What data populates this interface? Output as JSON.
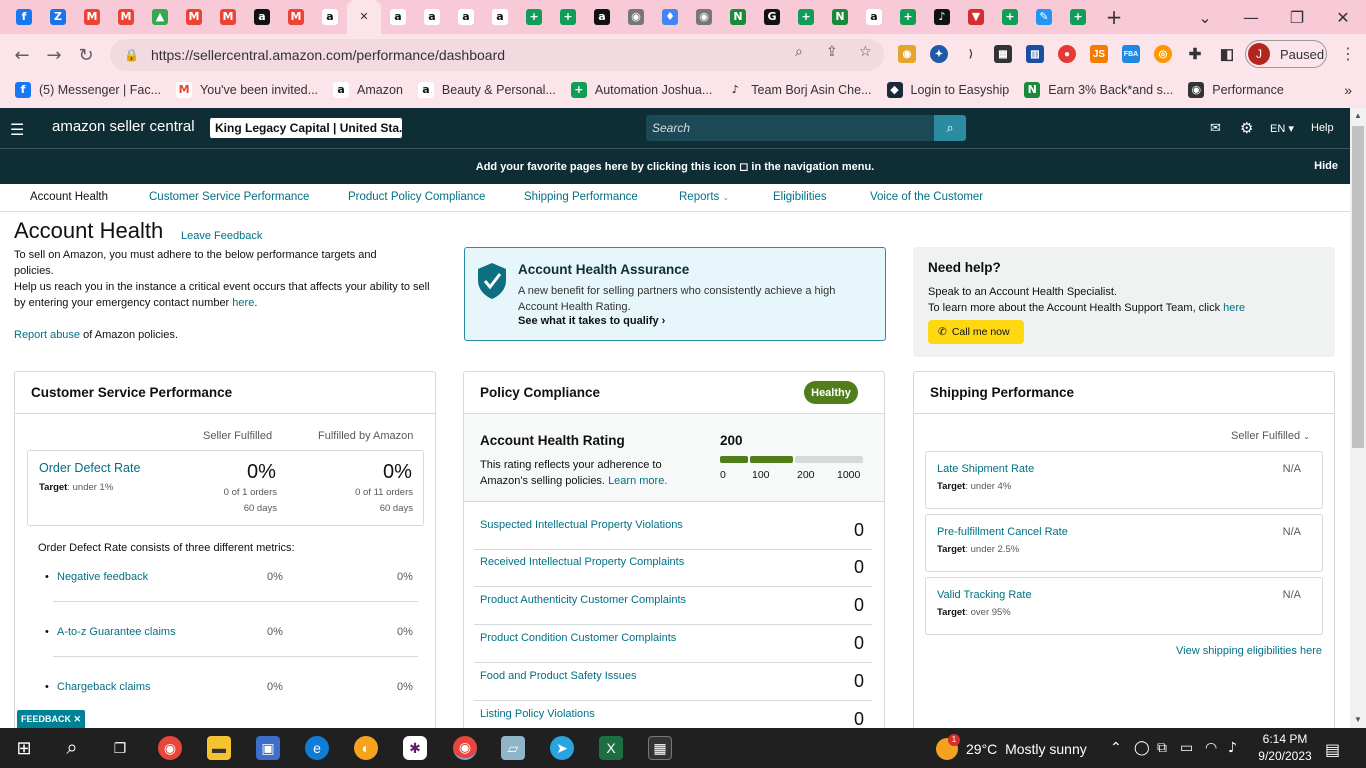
{
  "browser": {
    "tabs": [
      {
        "icon": "facebook-icon",
        "glyph": "f",
        "color": "#1877f2"
      },
      {
        "icon": "zoho-icon",
        "glyph": "Z",
        "color": "#1a73e8"
      },
      {
        "icon": "gmail-icon",
        "glyph": "M",
        "color": "#ea4335"
      },
      {
        "icon": "gmail-icon",
        "glyph": "M",
        "color": "#ea4335"
      },
      {
        "icon": "google-drive-icon",
        "glyph": "▲",
        "color": "#34a853"
      },
      {
        "icon": "gmail-icon",
        "glyph": "M",
        "color": "#ea4335"
      },
      {
        "icon": "gmail-icon",
        "glyph": "M",
        "color": "#ea4335"
      },
      {
        "icon": "amazon-icon",
        "glyph": "a",
        "color": "#ffffff"
      },
      {
        "icon": "gmail-icon",
        "glyph": "M",
        "color": "#ea4335"
      },
      {
        "icon": "amazon-icon",
        "glyph": "a",
        "color": "#111111"
      },
      {
        "icon": "close-tab-icon",
        "glyph": "✕",
        "color": "#333333"
      },
      {
        "icon": "amazon-icon",
        "glyph": "a",
        "color": "#111111"
      },
      {
        "icon": "amazon-icon",
        "glyph": "a",
        "color": "#111111"
      },
      {
        "icon": "amazon-icon",
        "glyph": "a",
        "color": "#111111"
      },
      {
        "icon": "amazon-icon",
        "glyph": "a",
        "color": "#111111"
      },
      {
        "icon": "google-sheets-icon",
        "glyph": "+",
        "color": "#0f9d58"
      },
      {
        "icon": "google-sheets-icon",
        "glyph": "+",
        "color": "#0f9d58"
      },
      {
        "icon": "amazon-icon",
        "glyph": "a",
        "color": "#ffffff"
      },
      {
        "icon": "globe-icon",
        "glyph": "◉",
        "color": "#777777"
      },
      {
        "icon": "google-maps-icon",
        "glyph": "♦",
        "color": "#4285f4"
      },
      {
        "icon": "globe-icon",
        "glyph": "◉",
        "color": "#777777"
      },
      {
        "icon": "vine-icon",
        "glyph": "N",
        "color": "#1a8a3a"
      },
      {
        "icon": "google-icon",
        "glyph": "G",
        "color": "#ffffff"
      },
      {
        "icon": "google-sheets-icon",
        "glyph": "+",
        "color": "#0f9d58"
      },
      {
        "icon": "vine-icon",
        "glyph": "N",
        "color": "#1a8a3a"
      },
      {
        "icon": "amazon-icon",
        "glyph": "a",
        "color": "#111111"
      },
      {
        "icon": "google-sheets-icon",
        "glyph": "+",
        "color": "#0f9d58"
      },
      {
        "icon": "tab-icon",
        "glyph": "♪",
        "color": "#ffffff"
      },
      {
        "icon": "triangle-icon",
        "glyph": "▼",
        "color": "#d32f2f"
      },
      {
        "icon": "google-sheets-icon",
        "glyph": "+",
        "color": "#0f9d58"
      },
      {
        "icon": "pencil-icon",
        "glyph": "✎",
        "color": "#2196f3"
      },
      {
        "icon": "google-sheets-icon",
        "glyph": "+",
        "color": "#0f9d58"
      }
    ],
    "url": "https://sellercentral.amazon.com/performance/dashboard",
    "profile_initial": "J",
    "profile_status": "Paused",
    "bookmarks": [
      {
        "label": "(5) Messenger | Fac...",
        "icon": "facebook-icon"
      },
      {
        "label": "You've been invited...",
        "icon": "gmail-icon"
      },
      {
        "label": "Amazon",
        "icon": "amazon-icon"
      },
      {
        "label": "Beauty & Personal...",
        "icon": "amazon-icon"
      },
      {
        "label": "Automation Joshua...",
        "icon": "google-sheets-icon"
      },
      {
        "label": "Team Borj Asin Che...",
        "icon": "tab-icon"
      },
      {
        "label": "Login to Easyship",
        "icon": "easyship-icon"
      },
      {
        "label": "Earn 3% Back*and s...",
        "icon": "vine-icon"
      },
      {
        "label": "Performance",
        "icon": "globe-icon"
      }
    ]
  },
  "seller": {
    "logo": "amazon seller central",
    "store": "King Legacy Capital | United Sta...",
    "search_placeholder": "Search",
    "lang": "EN",
    "help": "Help",
    "hint": "Add your favorite pages here by clicking this icon ◻ in the navigation menu.",
    "hide": "Hide",
    "nav": [
      "Account Health",
      "Customer Service Performance",
      "Product Policy Compliance",
      "Shipping Performance",
      "Reports",
      "Eligibilities",
      "Voice of the Customer"
    ]
  },
  "page": {
    "title": "Account Health",
    "leave_feedback": "Leave Feedback",
    "intro1": "To sell on Amazon, you must adhere to the below performance targets and policies.",
    "intro2": "Help us reach you in the instance a critical event occurs that affects your ability to sell by entering your emergency contact number",
    "intro2_link": "here",
    "report_abuse_link": "Report abuse",
    "report_abuse_text": "of Amazon policies.",
    "aha_title": "Account Health Assurance",
    "aha_desc": "A new benefit for selling partners who consistently achieve a high Account Health Rating.",
    "aha_link": "See what it takes to qualify",
    "help_title": "Need help?",
    "help_line1": "Speak to an Account Health Specialist.",
    "help_line2": "To learn more about the Account Health Support Team, click",
    "help_link": "here",
    "call_btn": "Call me now"
  },
  "csp": {
    "title": "Customer Service Performance",
    "col1": "Seller Fulfilled",
    "col2": "Fulfilled by Amazon",
    "odr_title": "Order Defect Rate",
    "odr_target_label": "Target",
    "odr_target": ": under 1%",
    "sf_pct": "0%",
    "sf_orders": "0 of 1 orders",
    "sf_days": "60 days",
    "fba_pct": "0%",
    "fba_orders": "0 of 11 orders",
    "fba_days": "60 days",
    "consists": "Order Defect Rate consists of three different metrics:",
    "metrics": [
      {
        "name": "Negative feedback",
        "sf": "0%",
        "fba": "0%"
      },
      {
        "name": "A-to-z Guarantee claims",
        "sf": "0%",
        "fba": "0%"
      },
      {
        "name": "Chargeback claims",
        "sf": "0%",
        "fba": "0%"
      }
    ]
  },
  "policy": {
    "title": "Policy Compliance",
    "status": "Healthy",
    "ahr_title": "Account Health Rating",
    "ahr_value": "200",
    "ahr_desc": "This rating reflects your adherence to Amazon's selling policies.",
    "ahr_link": "Learn more.",
    "scale": [
      "0",
      "100",
      "200",
      "1000"
    ],
    "scale_filled_segments": 2,
    "rows": [
      {
        "label": "Suspected Intellectual Property Violations",
        "value": "0"
      },
      {
        "label": "Received Intellectual Property Complaints",
        "value": "0"
      },
      {
        "label": "Product Authenticity Customer Complaints",
        "value": "0"
      },
      {
        "label": "Product Condition Customer Complaints",
        "value": "0"
      },
      {
        "label": "Food and Product Safety Issues",
        "value": "0"
      },
      {
        "label": "Listing Policy Violations",
        "value": "0"
      }
    ]
  },
  "shipping": {
    "title": "Shipping Performance",
    "filter": "Seller Fulfilled",
    "rows": [
      {
        "name": "Late Shipment Rate",
        "target_label": "Target",
        "target": ": under 4%",
        "value": "N/A"
      },
      {
        "name": "Pre-fulfillment Cancel Rate",
        "target_label": "Target",
        "target": ": under 2.5%",
        "value": "N/A"
      },
      {
        "name": "Valid Tracking Rate",
        "target_label": "Target",
        "target": ": over 95%",
        "value": "N/A"
      }
    ],
    "link": "View shipping eligibilities here"
  },
  "feedback": "FEEDBACK",
  "taskbar": {
    "weather_temp": "29°C",
    "weather_desc": "Mostly sunny",
    "weather_badge": "1",
    "time": "6:14 PM",
    "date": "9/20/2023"
  },
  "colors": {
    "accent": "#007185",
    "header": "#0f2d35",
    "healthy": "#507e1b",
    "call": "#ffd814"
  }
}
